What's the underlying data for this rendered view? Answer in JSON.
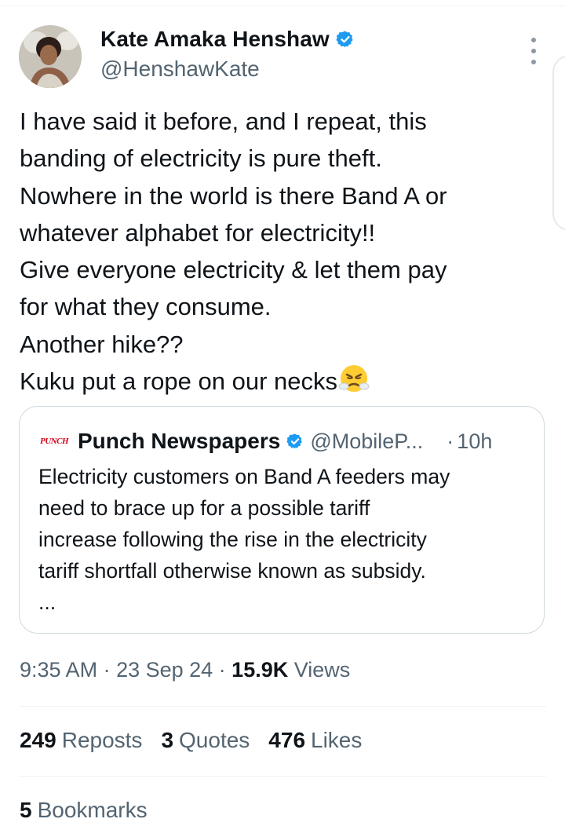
{
  "author": {
    "name": "Kate Amaka Henshaw",
    "handle": "@HenshawKate"
  },
  "tweet": {
    "lines": [
      "I have said it before, and I repeat, this",
      "banding of electricity is pure theft.",
      "Nowhere in the world is there Band A or",
      "whatever alphabet for electricity!!",
      "Give everyone electricity & let them pay",
      "for what they consume.",
      "Another hike??",
      "Kuku put a rope on our necks"
    ],
    "trailing_emoji": "steam-from-nose-face-icon"
  },
  "quote": {
    "logo_text": "PUNCH",
    "name": "Punch Newspapers",
    "handle": "@MobileP...",
    "separator": "·",
    "time": "10h",
    "lines": [
      "Electricity customers on Band A feeders may",
      "need to brace up for a possible tariff",
      "increase following the rise in the electricity",
      "tariff shortfall otherwise known as subsidy.",
      "..."
    ]
  },
  "meta": {
    "time": "9:35 AM",
    "sep1": " · ",
    "date": "23 Sep 24",
    "sep2": " · ",
    "views_count": "15.9K",
    "views_label": " Views"
  },
  "stats": {
    "reposts_count": "249",
    "reposts_label": "Reposts",
    "quotes_count": "3",
    "quotes_label": "Quotes",
    "likes_count": "476",
    "likes_label": "Likes",
    "bookmarks_count": "5",
    "bookmarks_label": "Bookmarks"
  },
  "colors": {
    "verified_blue": "#1d9bf0",
    "secondary_text": "#536471",
    "primary_text": "#0f1419",
    "punch_red": "#d0021b"
  }
}
